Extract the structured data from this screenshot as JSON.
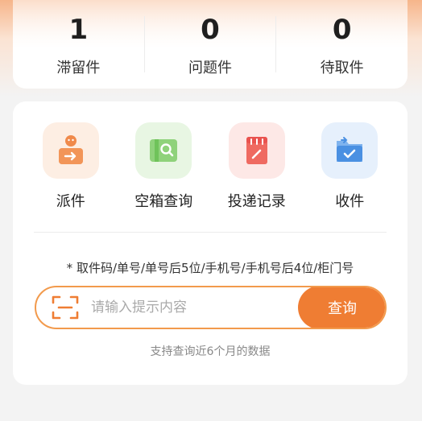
{
  "stats": [
    {
      "value": "1",
      "label": "滞留件"
    },
    {
      "value": "0",
      "label": "问题件"
    },
    {
      "value": "0",
      "label": "待取件"
    }
  ],
  "actions": [
    {
      "label": "派件",
      "icon": "courier-dispatch-icon",
      "color": "#f08a4b"
    },
    {
      "label": "空箱查询",
      "icon": "empty-box-search-icon",
      "color": "#6fc35a"
    },
    {
      "label": "投递记录",
      "icon": "delivery-record-icon",
      "color": "#e9534f"
    },
    {
      "label": "收件",
      "icon": "receive-parcel-icon",
      "color": "#4a90e2"
    }
  ],
  "search": {
    "hint": "* 取件码/单号/单号后5位/手机号/手机号后4位/柜门号",
    "placeholder": "请输入提示内容",
    "button_label": "查询",
    "note": "支持查询近6个月的数据"
  },
  "colors": {
    "accent": "#ef7d33",
    "border": "#f29a4c"
  }
}
